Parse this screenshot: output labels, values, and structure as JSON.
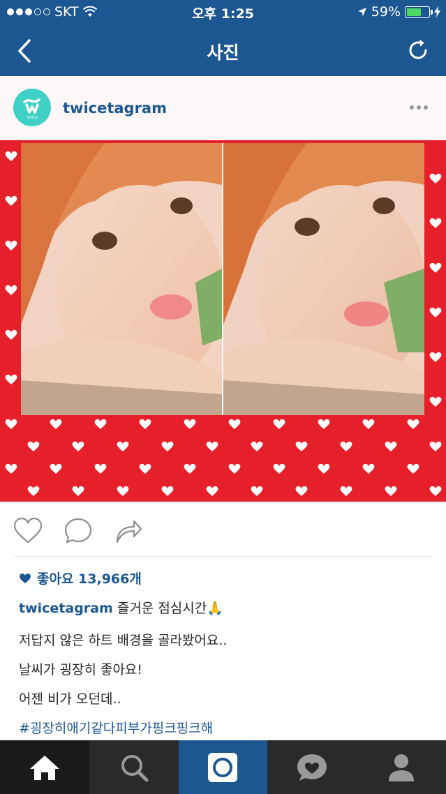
{
  "status_bar": {
    "carrier": "SKT",
    "time": "오후 1:25",
    "battery": "59%"
  },
  "nav": {
    "title": "사진",
    "back_icon": "chevron-left-icon",
    "refresh_icon": "refresh-icon"
  },
  "post": {
    "username": "twicetagram",
    "avatar_logo": "TWICE",
    "likes_label": "좋아요 13,966개",
    "caption_user": "twicetagram",
    "caption_text": "즐거운 점심시간🙏",
    "lines": [
      "저답지 않은 하트 배경을 골라봤어요..",
      "날씨가 굉장히 좋아요!",
      "어젠 비가 오던데.."
    ],
    "hashtag": "#굉장히애기같다피부가핑크핑크해"
  },
  "colors": {
    "header_blue": "#1c5791",
    "photo_red": "#e6202a",
    "avatar_teal": "#40d0c6",
    "tab_dark": "#2a2a2a"
  },
  "tabs": [
    "home-icon",
    "search-icon",
    "camera-icon",
    "activity-icon",
    "profile-icon"
  ]
}
